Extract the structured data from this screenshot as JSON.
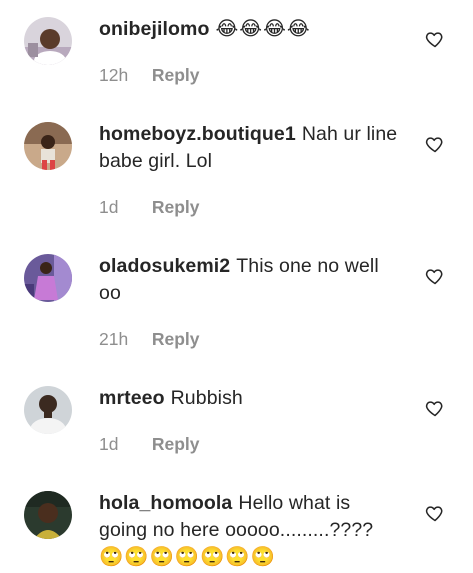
{
  "comments": [
    {
      "username": "onibejilomo",
      "text": "😂😂😂😂",
      "time": "12h",
      "reply_label": "Reply"
    },
    {
      "username": "homeboyz.boutique1",
      "text": "Nah ur line babe girl. Lol",
      "time": "1d",
      "reply_label": "Reply"
    },
    {
      "username": "oladosukemi2",
      "text": "This one no well oo",
      "time": "21h",
      "reply_label": "Reply"
    },
    {
      "username": "mrteeo",
      "text": "Rubbish",
      "time": "1d",
      "reply_label": "Reply"
    },
    {
      "username": "hola_homoola",
      "text": "Hello what is going no here ooooo.........????",
      "emoji_line": "🙄🙄🙄🙄🙄🙄🙄"
    }
  ],
  "icons": {
    "like": "heart-outline-icon",
    "avatar": "profile-picture"
  },
  "colors": {
    "text": "#262626",
    "meta": "#8e8e8e",
    "background": "#ffffff"
  }
}
